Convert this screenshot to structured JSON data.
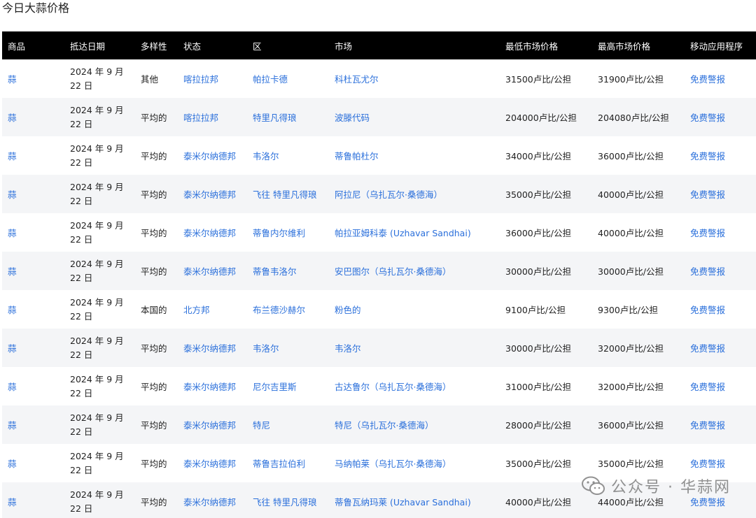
{
  "page": {
    "title": "今日大蒜价格"
  },
  "table": {
    "headers": [
      "商品",
      "抵达日期",
      "多样性",
      "状态",
      "区",
      "市场",
      "最低市场价格",
      "最高市场价格",
      "移动应用程序"
    ],
    "rows": [
      {
        "commodity": "蒜",
        "date_line1": "2024 年 9 月",
        "date_line2": "22 日",
        "variety": "其他",
        "state": "喀拉拉邦",
        "district": "帕拉卡德",
        "market": "科杜瓦尤尔",
        "min_price": "31500卢比/公担",
        "max_price": "31900卢比/公担",
        "app": "免费警报"
      },
      {
        "commodity": "蒜",
        "date_line1": "2024 年 9 月",
        "date_line2": "22 日",
        "variety": "平均的",
        "state": "喀拉拉邦",
        "district": "特里凡得琅",
        "market": "波滕代码",
        "min_price": "204000卢比/公担",
        "max_price": "204080卢比/公担",
        "app": "免费警报"
      },
      {
        "commodity": "蒜",
        "date_line1": "2024 年 9 月",
        "date_line2": "22 日",
        "variety": "平均的",
        "state": "泰米尔纳德邦",
        "district": "韦洛尔",
        "market": "蒂鲁帕杜尔",
        "min_price": "34000卢比/公担",
        "max_price": "36000卢比/公担",
        "app": "免费警报"
      },
      {
        "commodity": "蒜",
        "date_line1": "2024 年 9 月",
        "date_line2": "22 日",
        "variety": "平均的",
        "state": "泰米尔纳德邦",
        "district": "飞往 特里凡得琅",
        "market": "阿拉尼（乌扎瓦尔·桑德海）",
        "min_price": "35000卢比/公担",
        "max_price": "40000卢比/公担",
        "app": "免费警报"
      },
      {
        "commodity": "蒜",
        "date_line1": "2024 年 9 月",
        "date_line2": "22 日",
        "variety": "平均的",
        "state": "泰米尔纳德邦",
        "district": "蒂鲁内尔维利",
        "market": "帕拉亚姆科泰 (Uzhavar Sandhai)",
        "min_price": "36000卢比/公担",
        "max_price": "40000卢比/公担",
        "app": "免费警报"
      },
      {
        "commodity": "蒜",
        "date_line1": "2024 年 9 月",
        "date_line2": "22 日",
        "variety": "平均的",
        "state": "泰米尔纳德邦",
        "district": "蒂鲁韦洛尔",
        "market": "安巴图尔（乌扎瓦尔·桑德海）",
        "min_price": "30000卢比/公担",
        "max_price": "30000卢比/公担",
        "app": "免费警报"
      },
      {
        "commodity": "蒜",
        "date_line1": "2024 年 9 月",
        "date_line2": "22 日",
        "variety": "本国的",
        "state": "北方邦",
        "district": "布兰德沙赫尔",
        "market": "粉色的",
        "min_price": "9100卢比/公担",
        "max_price": "9300卢比/公担",
        "app": "免费警报"
      },
      {
        "commodity": "蒜",
        "date_line1": "2024 年 9 月",
        "date_line2": "22 日",
        "variety": "平均的",
        "state": "泰米尔纳德邦",
        "district": "韦洛尔",
        "market": "韦洛尔",
        "min_price": "30000卢比/公担",
        "max_price": "32000卢比/公担",
        "app": "免费警报"
      },
      {
        "commodity": "蒜",
        "date_line1": "2024 年 9 月",
        "date_line2": "22 日",
        "variety": "平均的",
        "state": "泰米尔纳德邦",
        "district": "尼尔吉里斯",
        "market": "古达鲁尔（乌扎瓦尔·桑德海）",
        "min_price": "31000卢比/公担",
        "max_price": "32000卢比/公担",
        "app": "免费警报"
      },
      {
        "commodity": "蒜",
        "date_line1": "2024 年 9 月",
        "date_line2": "22 日",
        "variety": "平均的",
        "state": "泰米尔纳德邦",
        "district": "特尼",
        "market": "特尼（乌扎瓦尔·桑德海）",
        "min_price": "28000卢比/公担",
        "max_price": "36000卢比/公担",
        "app": "免费警报"
      },
      {
        "commodity": "蒜",
        "date_line1": "2024 年 9 月",
        "date_line2": "22 日",
        "variety": "平均的",
        "state": "泰米尔纳德邦",
        "district": "蒂鲁吉拉伯利",
        "market": "马纳帕莱（乌扎瓦尔·桑德海）",
        "min_price": "35000卢比/公担",
        "max_price": "35000卢比/公担",
        "app": "免费警报"
      },
      {
        "commodity": "蒜",
        "date_line1": "2024 年 9 月",
        "date_line2": "22 日",
        "variety": "平均的",
        "state": "泰米尔纳德邦",
        "district": "飞往 特里凡得琅",
        "market": "蒂鲁瓦纳玛莱 (Uzhavar Sandhai)",
        "min_price": "40000卢比/公担",
        "max_price": "44000卢比/公担",
        "app": "免费警报"
      }
    ]
  },
  "watermark": {
    "text": "公众号 · 华蒜网",
    "icon": "wechat-icon"
  },
  "colors": {
    "header_bg": "#000000",
    "link": "#2a6fdb",
    "row_alt": "#f4f5f7"
  }
}
